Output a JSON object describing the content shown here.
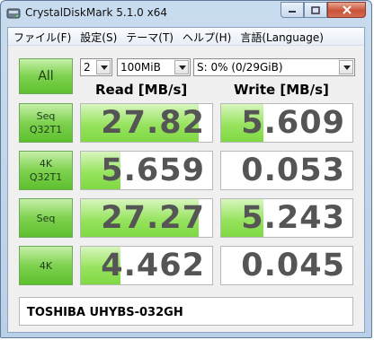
{
  "window": {
    "title": "CrystalDiskMark 5.1.0 x64"
  },
  "menu": [
    "ファイル(F)",
    "設定(S)",
    "テーマ(T)",
    "ヘルプ(H)",
    "言語(Language)"
  ],
  "controls": {
    "all_label": "All",
    "count_value": "2",
    "size_value": "100MiB",
    "drive_value": "S: 0% (0/29GiB)"
  },
  "headers": {
    "read": "Read [MB/s]",
    "write": "Write [MB/s]"
  },
  "rows": [
    {
      "label_line1": "Seq",
      "label_line2": "Q32T1",
      "read": "27.82",
      "write": "5.609"
    },
    {
      "label_line1": "4K",
      "label_line2": "Q32T1",
      "read": "5.659",
      "write": "0.053"
    },
    {
      "label_line1": "Seq",
      "label_line2": "",
      "read": "27.27",
      "write": "5.243"
    },
    {
      "label_line1": "4K",
      "label_line2": "",
      "read": "4.462",
      "write": "0.045"
    }
  ],
  "comment": "TOSHIBA UHYBS-032GH",
  "colors": {
    "accent_green": "#7ed14f",
    "close_red": "#c9533a"
  },
  "icons": [
    "app-icon",
    "minimize-icon",
    "maximize-icon",
    "close-icon",
    "dropdown-arrow-icon"
  ]
}
